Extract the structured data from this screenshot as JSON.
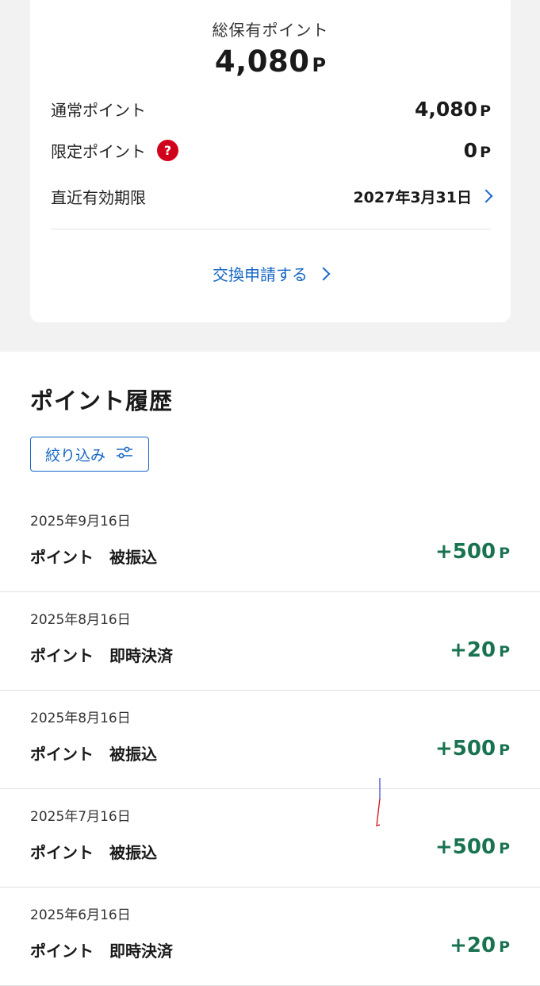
{
  "summary": {
    "total_label": "総保有ポイント",
    "total_value": "4,080",
    "unit": "P",
    "normal_label": "通常ポイント",
    "normal_value": "4,080",
    "limited_label": "限定ポイント",
    "limited_value": "0",
    "help_icon_glyph": "?",
    "expiry_label": "直近有効期限",
    "expiry_value": "2027年3月31日",
    "exchange_link": "交換申請する"
  },
  "history": {
    "title": "ポイント履歴",
    "filter_label": "絞り込み",
    "items": [
      {
        "date": "2025年9月16日",
        "desc": "ポイント　被振込",
        "amount": "+500"
      },
      {
        "date": "2025年8月16日",
        "desc": "ポイント　即時決済",
        "amount": "+20"
      },
      {
        "date": "2025年8月16日",
        "desc": "ポイント　被振込",
        "amount": "+500"
      },
      {
        "date": "2025年7月16日",
        "desc": "ポイント　被振込",
        "amount": "+500"
      },
      {
        "date": "2025年6月16日",
        "desc": "ポイント　即時決済",
        "amount": "+20"
      }
    ]
  },
  "colors": {
    "link_blue": "#1767c5",
    "amount_green": "#1a7350",
    "help_red": "#d0021b",
    "background_gray": "#f2f2f2"
  }
}
